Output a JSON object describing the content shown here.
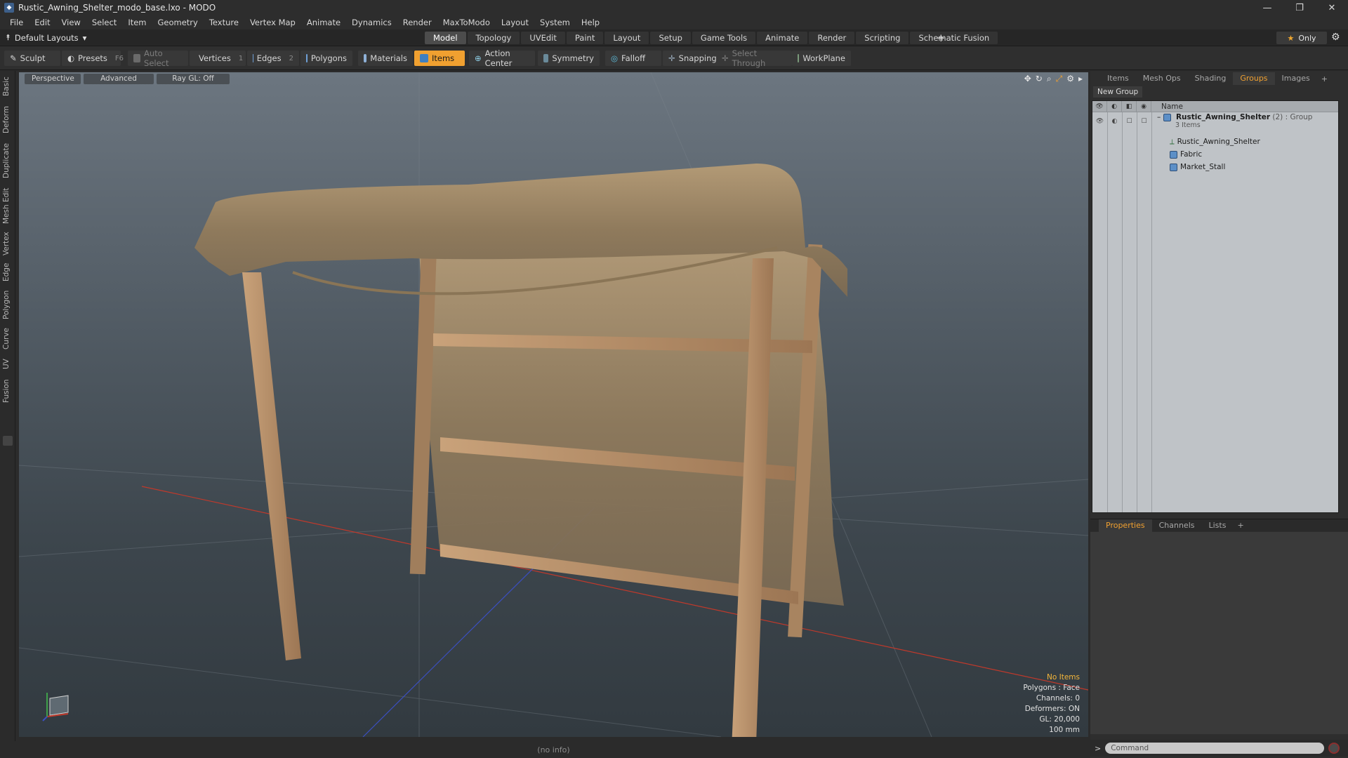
{
  "window": {
    "title": "Rustic_Awning_Shelter_modo_base.lxo - MODO",
    "controls": [
      "—",
      "❐",
      "✕"
    ]
  },
  "menu": [
    "File",
    "Edit",
    "View",
    "Select",
    "Item",
    "Geometry",
    "Texture",
    "Vertex Map",
    "Animate",
    "Dynamics",
    "Render",
    "MaxToModo",
    "Layout",
    "System",
    "Help"
  ],
  "layouts": {
    "current": "Default Layouts",
    "tabs": [
      "Model",
      "Topology",
      "UVEdit",
      "Paint",
      "Layout",
      "Setup",
      "Game Tools",
      "Animate",
      "Render",
      "Scripting",
      "Schematic Fusion"
    ],
    "active_tab": "Model",
    "only_label": "Only"
  },
  "toolbar": {
    "sculpt": "Sculpt",
    "presets": "Presets",
    "presets_key": "F6",
    "auto_select": "Auto Select",
    "vertices": "Vertices",
    "vertices_key": "1",
    "edges": "Edges",
    "edges_key": "2",
    "polygons": "Polygons",
    "materials": "Materials",
    "items": "Items",
    "action_center": "Action Center",
    "symmetry": "Symmetry",
    "falloff": "Falloff",
    "snapping": "Snapping",
    "select_through": "Select Through",
    "workplane": "WorkPlane"
  },
  "left_tabs": [
    "Basic",
    "Deform",
    "Duplicate",
    "Mesh Edit",
    "Vertex",
    "Edge",
    "Polygon",
    "Curve",
    "UV",
    "Fusion"
  ],
  "viewport": {
    "view": "Perspective",
    "shading": "Advanced",
    "raygl": "Ray GL: Off",
    "info": {
      "items": "No Items",
      "polygons": "Polygons : Face",
      "channels": "Channels: 0",
      "deformers": "Deformers: ON",
      "gl": "GL: 20,000",
      "scale": "100 mm"
    }
  },
  "status": "(no info)",
  "right_panel": {
    "tabs": [
      "Items",
      "Mesh Ops",
      "Shading",
      "Groups",
      "Images"
    ],
    "active_tab": "Groups",
    "new_group": "New Group",
    "column_name": "Name",
    "group": {
      "name": "Rustic_Awning_Shelter",
      "count": "(2)",
      "type": ": Group",
      "sub": "3 Items"
    },
    "children": [
      "Rustic_Awning_Shelter",
      "Fabric",
      "Market_Stall"
    ],
    "bottom_tabs": [
      "Properties",
      "Channels",
      "Lists"
    ],
    "bottom_active": "Properties",
    "command_placeholder": "Command"
  },
  "colors": {
    "accent": "#f0a030",
    "axis_x": "#c0392b",
    "axis_z": "#3b4fc0"
  }
}
